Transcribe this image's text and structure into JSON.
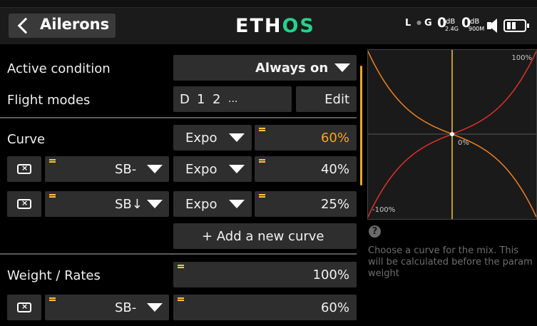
{
  "header": {
    "title": "Ailerons",
    "logo_main": "ETH",
    "logo_accent": "OS",
    "status": {
      "rx_symbol": "L",
      "gps_symbol": "G",
      "rssi_24": "0",
      "rssi_24_unit": "dB",
      "rssi_24_band": "2.4G",
      "rssi_900": "0",
      "rssi_900_unit": "dB",
      "rssi_900_band": "900M"
    }
  },
  "rows": {
    "active_condition": {
      "label": "Active condition",
      "value": "Always on"
    },
    "flight_modes": {
      "label": "Flight modes",
      "modes": [
        "D",
        "1",
        "2",
        "..."
      ],
      "edit_label": "Edit"
    },
    "curve": {
      "label": "Curve",
      "type": "Expo",
      "value": "60%"
    },
    "curve_alt1": {
      "switch": "SB-",
      "type": "Expo",
      "value": "40%"
    },
    "curve_alt2": {
      "switch": "SB↓",
      "type": "Expo",
      "value": "25%"
    },
    "add_curve_label": "+ Add a new curve",
    "weight": {
      "label": "Weight / Rates",
      "value": "100%"
    },
    "weight_alt1": {
      "switch": "SB-",
      "value": "60%"
    }
  },
  "graph": {
    "label_top": "100%",
    "label_bottom": "-100%",
    "label_center": "0%",
    "expo": 0.6,
    "curve_color_pos": "#e0302a",
    "curve_color_neg": "#f0801e",
    "axis_color": "#f5c542"
  },
  "help": {
    "icon": "?",
    "text": "Choose a curve for the mix. This will be calculated before the param weight"
  },
  "colors": {
    "accent": "#f5a623",
    "logo_accent": "#27d08c",
    "field_bg": "#2e2e2e"
  }
}
